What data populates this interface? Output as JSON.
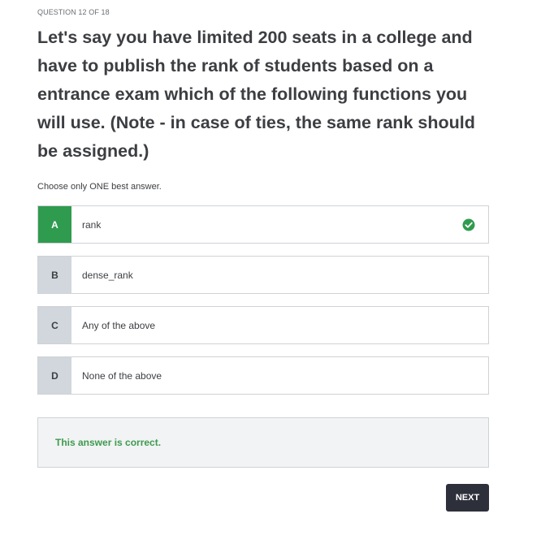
{
  "quiz": {
    "question_counter": "QUESTION 12 OF 18",
    "question_text": "Let's say you have limited 200 seats in a college and have to publish the rank of students based on a entrance exam which of the following functions you will use. (Note - in case of ties, the same rank should be assigned.)",
    "instruction": "Choose only ONE best answer.",
    "options": [
      {
        "letter": "A",
        "text": "rank",
        "state": "correct-selected"
      },
      {
        "letter": "B",
        "text": "dense_rank",
        "state": "unselected"
      },
      {
        "letter": "C",
        "text": "Any of the above",
        "state": "unselected"
      },
      {
        "letter": "D",
        "text": "None of the above",
        "state": "unselected"
      }
    ],
    "feedback": "This answer is correct.",
    "next_label": "NEXT"
  },
  "colors": {
    "correct_green": "#2f9b4f",
    "feedback_text": "#3d9a4f",
    "button_dark": "#2d2f3a",
    "letter_gray": "#d1d7dc"
  },
  "icons": {
    "correct_mark": "check-circle-icon"
  }
}
